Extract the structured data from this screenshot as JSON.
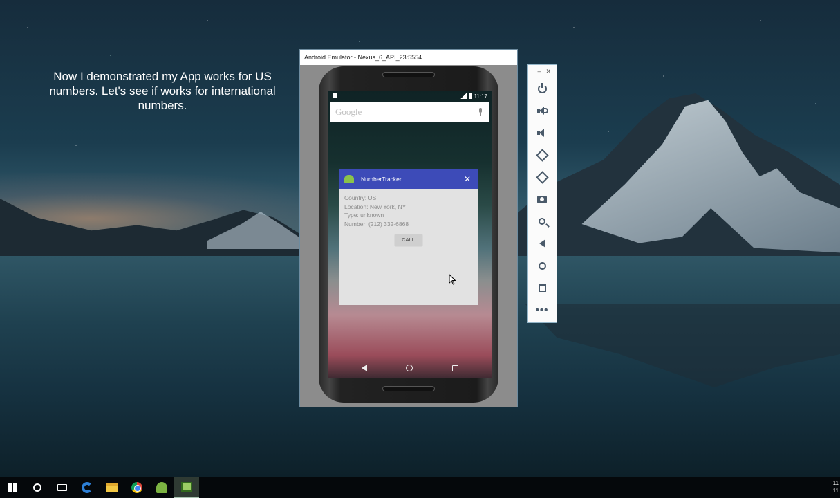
{
  "caption": {
    "text": "Now I demonstrated my App works for US numbers. Let's see if works for international numbers."
  },
  "emulator": {
    "window_title": "Android Emulator - Nexus_6_API_23:5554",
    "status_time": "11:17",
    "search_placeholder": "Google",
    "dialog": {
      "title": "NumberTracker",
      "close_glyph": "✕",
      "country": "Country: US",
      "location": "Location: New York, NY",
      "type": "Type: unknown",
      "number": "Number: (212) 332-6868",
      "call_label": "CALL"
    }
  },
  "emulator_toolbar": {
    "minimize_glyph": "–",
    "close_glyph": "✕",
    "buttons": [
      {
        "icon": "power-icon"
      },
      {
        "icon": "volume-up-icon"
      },
      {
        "icon": "volume-down-icon"
      },
      {
        "icon": "rotate-left-icon"
      },
      {
        "icon": "rotate-right-icon"
      },
      {
        "icon": "camera-icon"
      },
      {
        "icon": "zoom-icon"
      },
      {
        "icon": "back-icon"
      },
      {
        "icon": "home-icon"
      },
      {
        "icon": "overview-icon"
      },
      {
        "icon": "more-icon"
      }
    ],
    "more_glyph": "•••"
  },
  "taskbar": {
    "items": [
      "start",
      "cortana",
      "task-view",
      "edge",
      "file-explorer",
      "chrome",
      "android-studio",
      "android-emulator"
    ],
    "clock_line1": "11",
    "clock_line2": "11"
  },
  "colors": {
    "dialog_header": "#3d4bb8",
    "taskbar": "#05080b",
    "toolbar_icons": "#4a5a6a"
  }
}
